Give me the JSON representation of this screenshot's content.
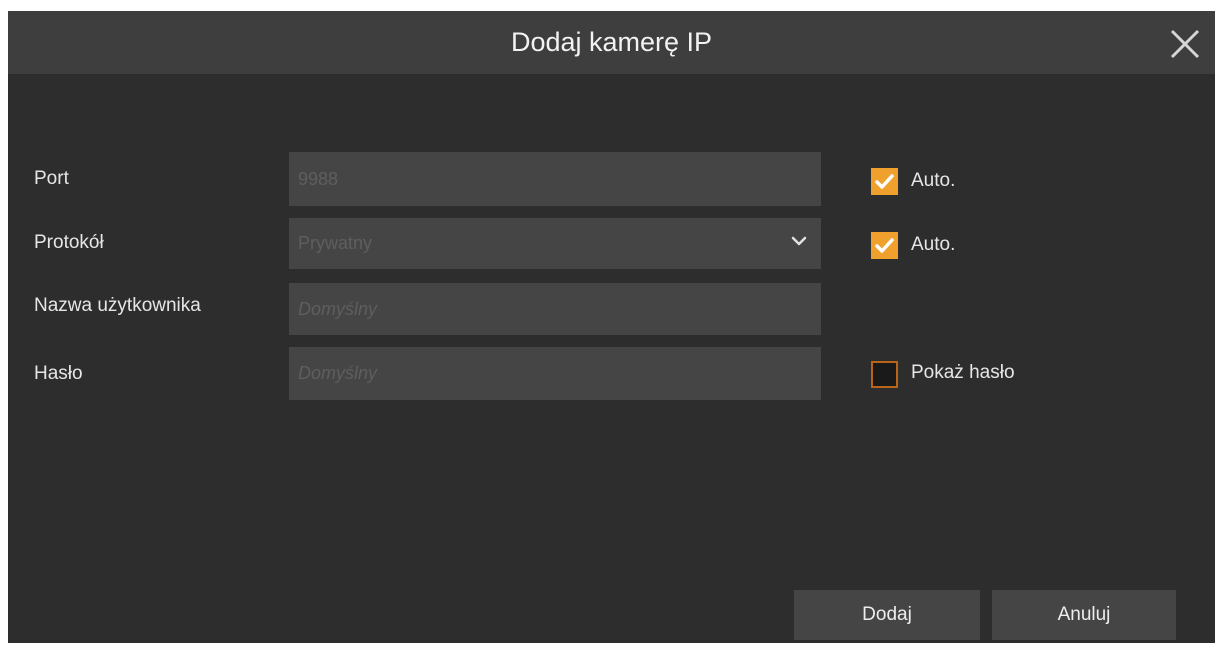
{
  "dialog": {
    "title": "Dodaj kamerę IP"
  },
  "form": {
    "port": {
      "label": "Port",
      "value": "9988",
      "auto_checked": true,
      "auto_label": "Auto."
    },
    "protocol": {
      "label": "Protokół",
      "selected": "Prywatny",
      "auto_checked": true,
      "auto_label": "Auto."
    },
    "username": {
      "label": "Nazwa użytkownika",
      "placeholder": "Domyślny"
    },
    "password": {
      "label": "Hasło",
      "placeholder": "Domyślny",
      "show_checked": false,
      "show_label": "Pokaż hasło"
    }
  },
  "buttons": {
    "add_label": "Dodaj",
    "cancel_label": "Anuluj"
  },
  "icons": {
    "close": "close-icon",
    "dropdown": "chevron-down-icon",
    "checkmark": "check-icon"
  },
  "colors": {
    "dialog_bg": "#2d2d2d",
    "titlebar_bg": "#3e3e3e",
    "field_bg": "#454545",
    "accent": "#f0a02c",
    "unchecked_border": "#b8651a"
  }
}
